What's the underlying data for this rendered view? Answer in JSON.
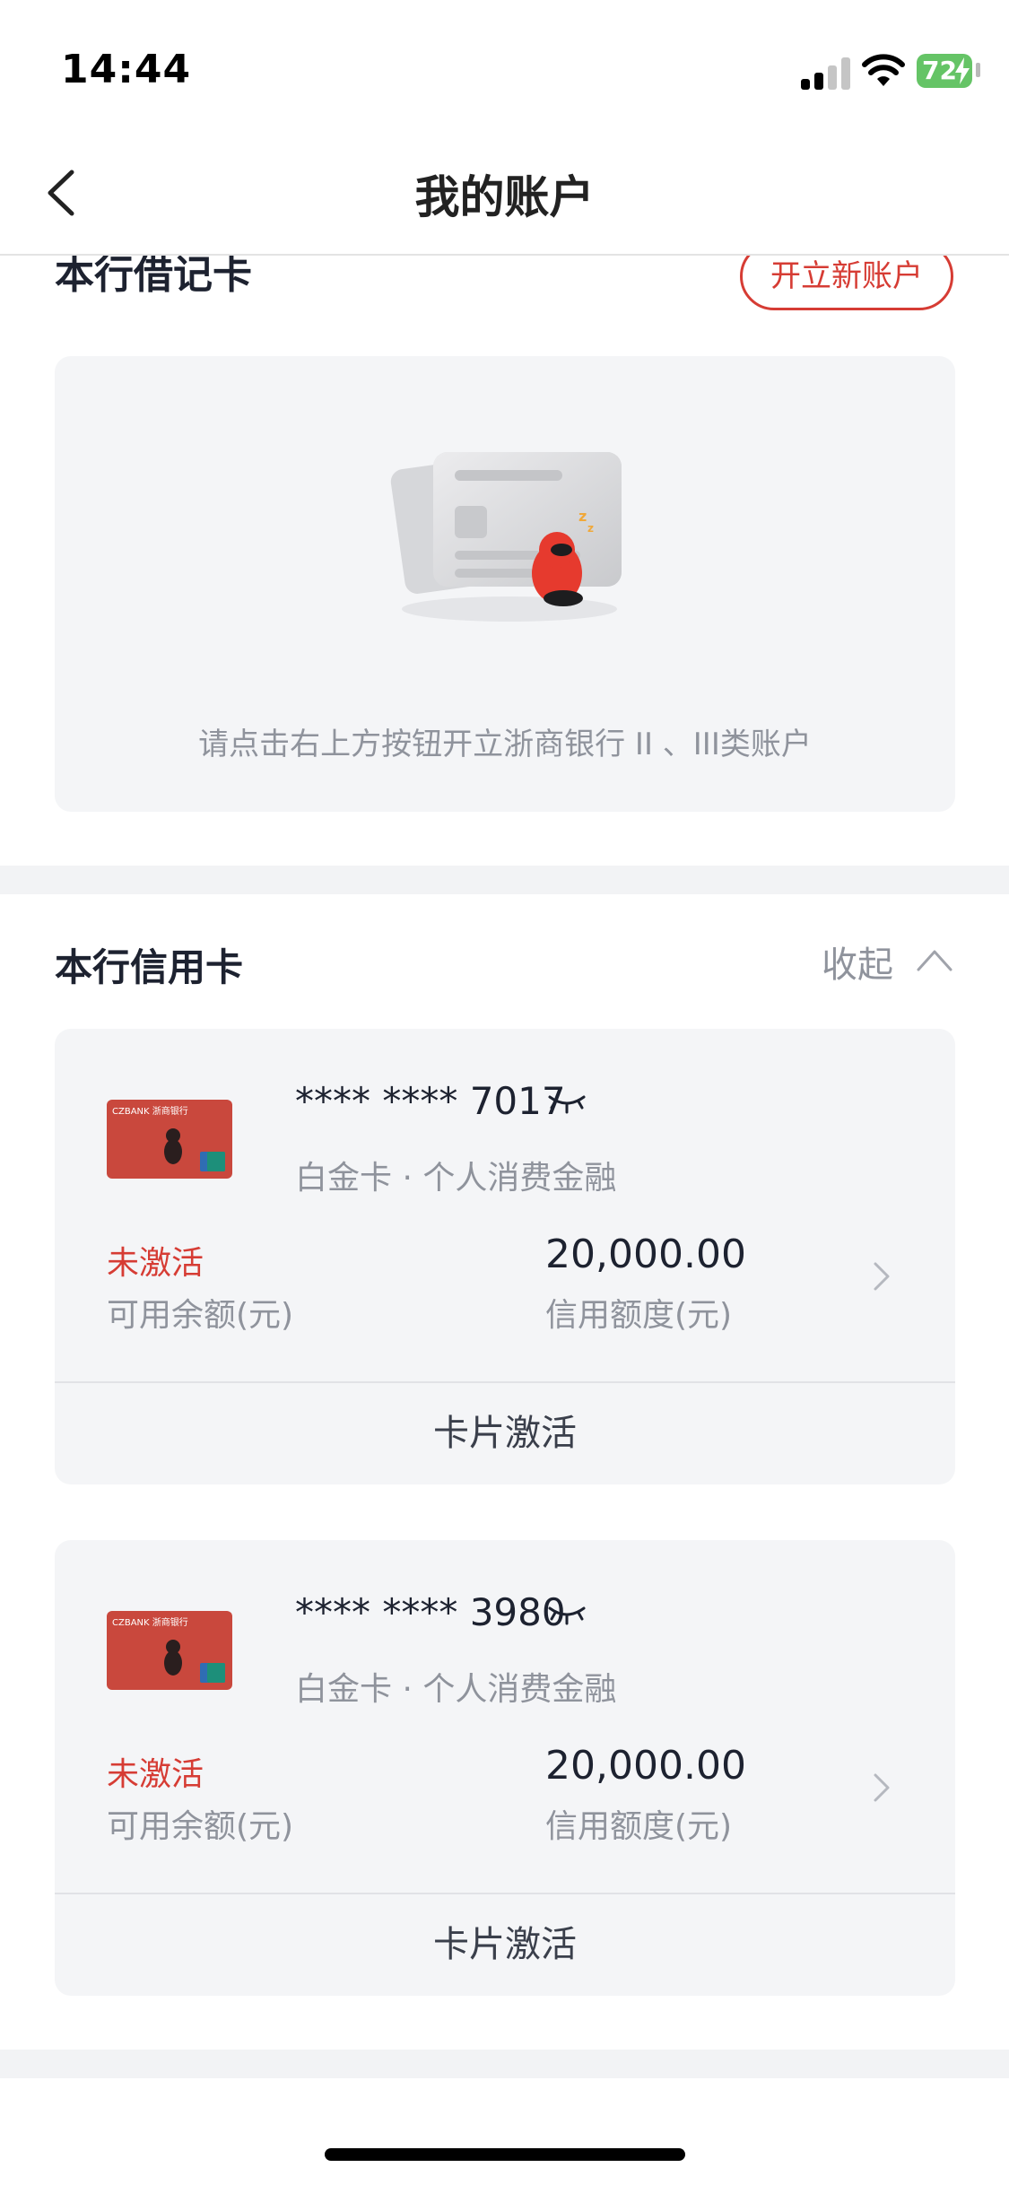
{
  "status_bar": {
    "time": "14:44",
    "battery": "72"
  },
  "header": {
    "title": "我的账户",
    "back_icon": "chevron-left-icon"
  },
  "debit": {
    "title": "本行借记卡",
    "open_account_label": "开立新账户",
    "empty_hint": "请点击右上方按钮开立浙商银行 II 、III类账户"
  },
  "credit": {
    "title": "本行信用卡",
    "collapse_label": "收起",
    "cards": [
      {
        "number": "**** **** 7017",
        "type": "白金卡 · 个人消费金融",
        "status": "未激活",
        "balance_label": "可用余额(元)",
        "limit_value": "20,000.00",
        "limit_label": "信用额度(元)",
        "activate_label": "卡片激活"
      },
      {
        "number": "**** **** 3980",
        "type": "白金卡 · 个人消费金融",
        "status": "未激活",
        "balance_label": "可用余额(元)",
        "limit_value": "20,000.00",
        "limit_label": "信用额度(元)",
        "activate_label": "卡片激活"
      }
    ],
    "card_brand": "CZBANK 浙商银行"
  },
  "colors": {
    "accent_red": "#d63c34",
    "panel_bg": "#f4f5f7",
    "muted_text": "#8f939c"
  }
}
